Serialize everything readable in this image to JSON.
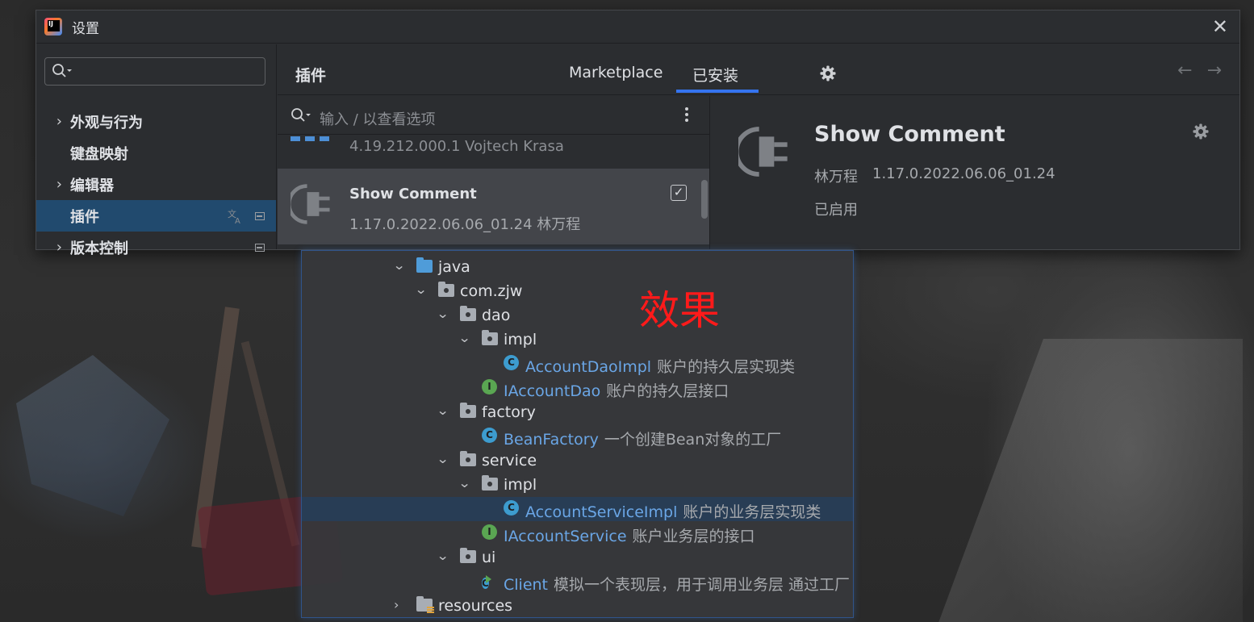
{
  "window": {
    "title": "设置"
  },
  "sidebar": {
    "search_placeholder": "",
    "items": [
      {
        "label": "外观与行为",
        "expandable": true
      },
      {
        "label": "键盘映射",
        "expandable": false
      },
      {
        "label": "编辑器",
        "expandable": true
      },
      {
        "label": "插件",
        "expandable": false,
        "selected": true
      },
      {
        "label": "版本控制",
        "expandable": true
      }
    ]
  },
  "header": {
    "title": "插件",
    "tabs": [
      {
        "label": "Marketplace"
      },
      {
        "label": "已安装",
        "active": true
      }
    ]
  },
  "plugin_list": {
    "search_placeholder": "输入 / 以查看选项",
    "prev_item_meta": "4.19.212.000.1  Vojtech Krasa",
    "selected_item": {
      "name": "Show Comment",
      "meta": "1.17.0.2022.06.06_01.24  林万程",
      "enabled": true
    }
  },
  "detail": {
    "name": "Show Comment",
    "author": "林万程",
    "version": "1.17.0.2022.06.06_01.24",
    "status": "已启用"
  },
  "tree": {
    "overlay_text": "效果",
    "rows": [
      {
        "label": "java",
        "comment": ""
      },
      {
        "label": "com.zjw",
        "comment": ""
      },
      {
        "label": "dao",
        "comment": ""
      },
      {
        "label": "impl",
        "comment": ""
      },
      {
        "label": "AccountDaoImpl",
        "comment": "账户的持久层实现类"
      },
      {
        "label": "IAccountDao",
        "comment": "账户的持久层接口"
      },
      {
        "label": "factory",
        "comment": ""
      },
      {
        "label": "BeanFactory",
        "comment": "一个创建Bean对象的工厂"
      },
      {
        "label": "service",
        "comment": ""
      },
      {
        "label": "impl",
        "comment": ""
      },
      {
        "label": "AccountServiceImpl",
        "comment": "账户的业务层实现类"
      },
      {
        "label": "IAccountService",
        "comment": "账户业务层的接口"
      },
      {
        "label": "ui",
        "comment": ""
      },
      {
        "label": "Client",
        "comment": "模拟一个表现层，用于调用业务层  通过工厂"
      },
      {
        "label": "resources",
        "comment": ""
      }
    ]
  },
  "colors": {
    "accent": "#3574f0",
    "selection": "#214a6e",
    "class_link": "#6aa6e6",
    "effect_text": "#ff1a1a"
  }
}
